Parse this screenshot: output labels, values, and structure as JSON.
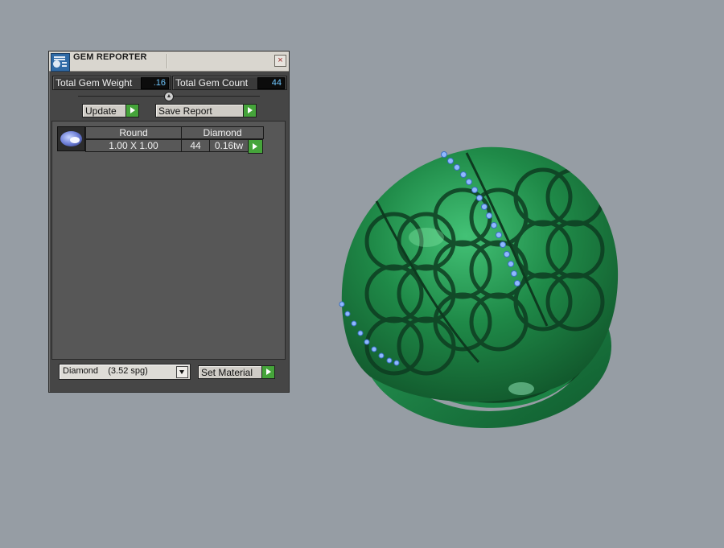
{
  "panel": {
    "title": "GEM REPORTER",
    "close_glyph": "×",
    "total_gem_weight_label": "Total Gem Weight",
    "total_gem_weight_value": ".16",
    "total_gem_count_label": "Total Gem Count",
    "total_gem_count_value": "44",
    "update_label": "Update",
    "save_report_label": "Save Report",
    "table": {
      "headers": [
        "Round",
        "Diamond"
      ],
      "rows": [
        {
          "size": "1.00 X 1.00",
          "count": "44",
          "weight": "0.16tw"
        }
      ]
    },
    "material_select_value": "Diamond    (3.52 spg)",
    "set_material_label": "Set Material"
  },
  "icons": {
    "title_icon": "gem-report-icon",
    "close": "close-icon",
    "arrow": "play-arrow-icon",
    "dropdown": "chevron-down-icon",
    "gem": "round-gem-icon"
  },
  "colors": {
    "background": "#969da4",
    "panel": "#464646",
    "value_text": "#6fc7ff",
    "arrow_button": "#45a43a",
    "ring_green": "#1f8a48",
    "gem_blue": "#8fb8ff"
  }
}
